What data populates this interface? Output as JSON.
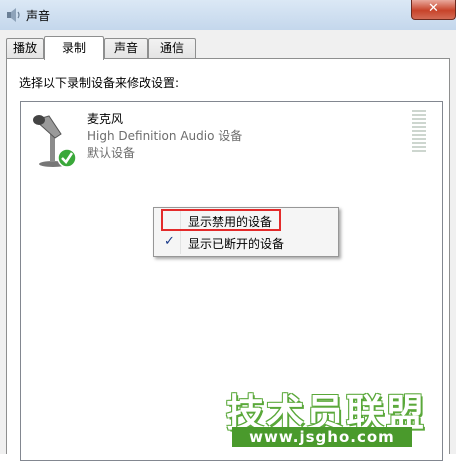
{
  "window": {
    "title": "声音",
    "close_symbol": "✕",
    "app_icon": "speaker-icon"
  },
  "tabs": [
    {
      "label": "播放",
      "active": false
    },
    {
      "label": "录制",
      "active": true
    },
    {
      "label": "声音",
      "active": false
    },
    {
      "label": "通信",
      "active": false
    }
  ],
  "recording": {
    "instruction": "选择以下录制设备来修改设置:",
    "device": {
      "name": "麦克风",
      "description": "High Definition Audio 设备",
      "status": "默认设备",
      "icon": "microphone-icon",
      "badge_icon": "default-check-icon"
    }
  },
  "context_menu": {
    "items": [
      {
        "label": "显示禁用的设备",
        "checked": false
      },
      {
        "label": "显示已断开的设备",
        "checked": true
      }
    ],
    "check_glyph": "✓",
    "highlight_color": "#e32a2a"
  },
  "watermark": {
    "text": "技术员联盟",
    "url": "www.jsgho.com",
    "color": "#4a9a2c"
  }
}
